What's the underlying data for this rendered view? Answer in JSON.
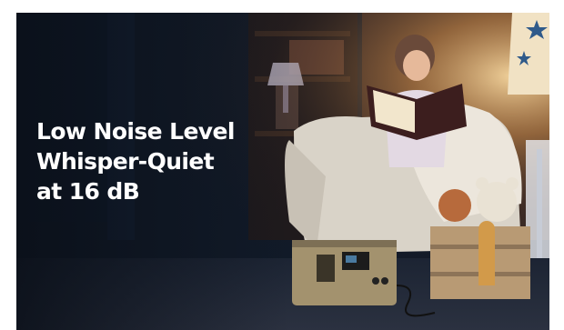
{
  "headline": {
    "lines": [
      "Low Noise Level",
      "Whisper-Quiet",
      "at 16 dB"
    ]
  },
  "colors": {
    "background_dark": "#0d1420",
    "lamp_glow": "#f4c27a",
    "headline_text": "#ffffff",
    "armchair": "#d9d3c8",
    "power_station": "#a3926e"
  },
  "icons": [
    "star-icon"
  ]
}
